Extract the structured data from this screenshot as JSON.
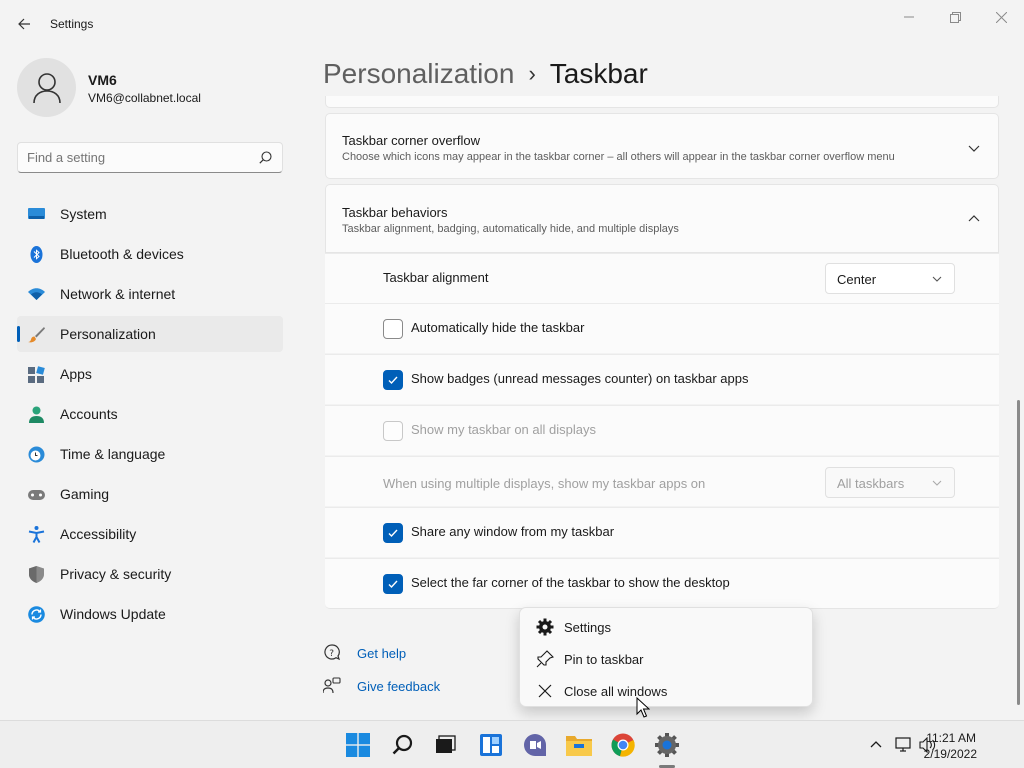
{
  "app": {
    "title": "Settings"
  },
  "user": {
    "name": "VM6",
    "email": "VM6@collabnet.local"
  },
  "search": {
    "placeholder": "Find a setting"
  },
  "nav": {
    "items": [
      {
        "label": "System",
        "icon": "monitor-icon"
      },
      {
        "label": "Bluetooth & devices",
        "icon": "bluetooth-icon"
      },
      {
        "label": "Network & internet",
        "icon": "wifi-icon"
      },
      {
        "label": "Personalization",
        "icon": "brush-icon",
        "selected": true
      },
      {
        "label": "Apps",
        "icon": "apps-icon"
      },
      {
        "label": "Accounts",
        "icon": "person-icon"
      },
      {
        "label": "Time & language",
        "icon": "clock-globe-icon"
      },
      {
        "label": "Gaming",
        "icon": "gamepad-icon"
      },
      {
        "label": "Accessibility",
        "icon": "accessibility-icon"
      },
      {
        "label": "Privacy & security",
        "icon": "shield-icon"
      },
      {
        "label": "Windows Update",
        "icon": "update-icon"
      }
    ]
  },
  "header": {
    "parent": "Personalization",
    "separator": "›",
    "current": "Taskbar"
  },
  "overflow_card": {
    "title": "Taskbar corner overflow",
    "subtitle": "Choose which icons may appear in the taskbar corner – all others will appear in the taskbar corner overflow menu"
  },
  "behaviors_card": {
    "title": "Taskbar behaviors",
    "subtitle": "Taskbar alignment, badging, automatically hide, and multiple displays",
    "alignment": {
      "label": "Taskbar alignment",
      "value": "Center"
    },
    "options": [
      {
        "label": "Automatically hide the taskbar",
        "checked": false,
        "disabled": false
      },
      {
        "label": "Show badges (unread messages counter) on taskbar apps",
        "checked": true,
        "disabled": false
      },
      {
        "label": "Show my taskbar on all displays",
        "checked": false,
        "disabled": true
      }
    ],
    "multi_display": {
      "label": "When using multiple displays, show my taskbar apps on",
      "value": "All taskbars",
      "disabled": true
    },
    "options2": [
      {
        "label": "Share any window from my taskbar",
        "checked": true
      },
      {
        "label": "Select the far corner of the taskbar to show the desktop",
        "checked": true
      }
    ]
  },
  "help": {
    "get_help": "Get help",
    "give_feedback": "Give feedback"
  },
  "context_menu": {
    "items": [
      {
        "label": "Settings",
        "icon": "gear-icon"
      },
      {
        "label": "Pin to taskbar",
        "icon": "pin-icon"
      },
      {
        "label": "Close all windows",
        "icon": "close-icon"
      }
    ]
  },
  "taskbar": {
    "apps": [
      "start-icon",
      "search-icon",
      "task-view-icon",
      "widgets-icon",
      "teams-chat-icon",
      "file-explorer-icon",
      "chrome-icon",
      "settings-icon"
    ],
    "clock": {
      "time": "11:21 AM",
      "date": "2/19/2022"
    }
  },
  "colors": {
    "accent": "#005fb8",
    "background": "#f3f3f3",
    "card": "#fbfbfb"
  }
}
